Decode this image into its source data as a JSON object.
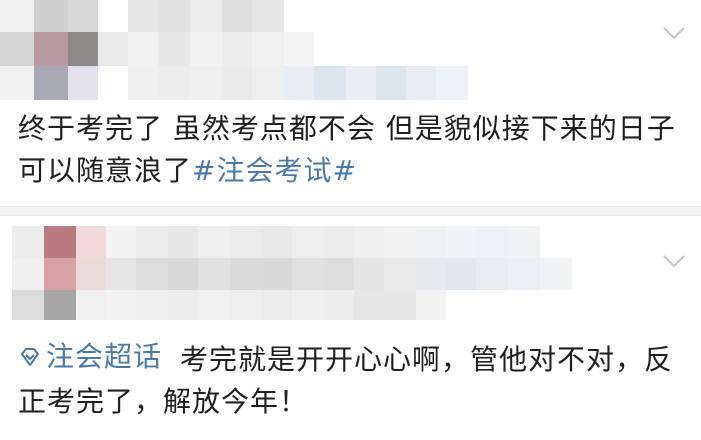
{
  "posts": [
    {
      "text_part1": "终于考完了  虽然考点都不会 但是貌似接下来的日子可以随意浪了",
      "topic": "#注会考试#"
    },
    {
      "supertopic_label": "注会超话",
      "text": "考完就是开开心心啊，管他对不对，反正考完了，解放今年！"
    }
  ],
  "icons": {
    "expand": "chevron-down-icon",
    "supertopic": "diamond-icon"
  },
  "colors": {
    "link": "#4a79a8",
    "separator": "#f2f2f2"
  }
}
